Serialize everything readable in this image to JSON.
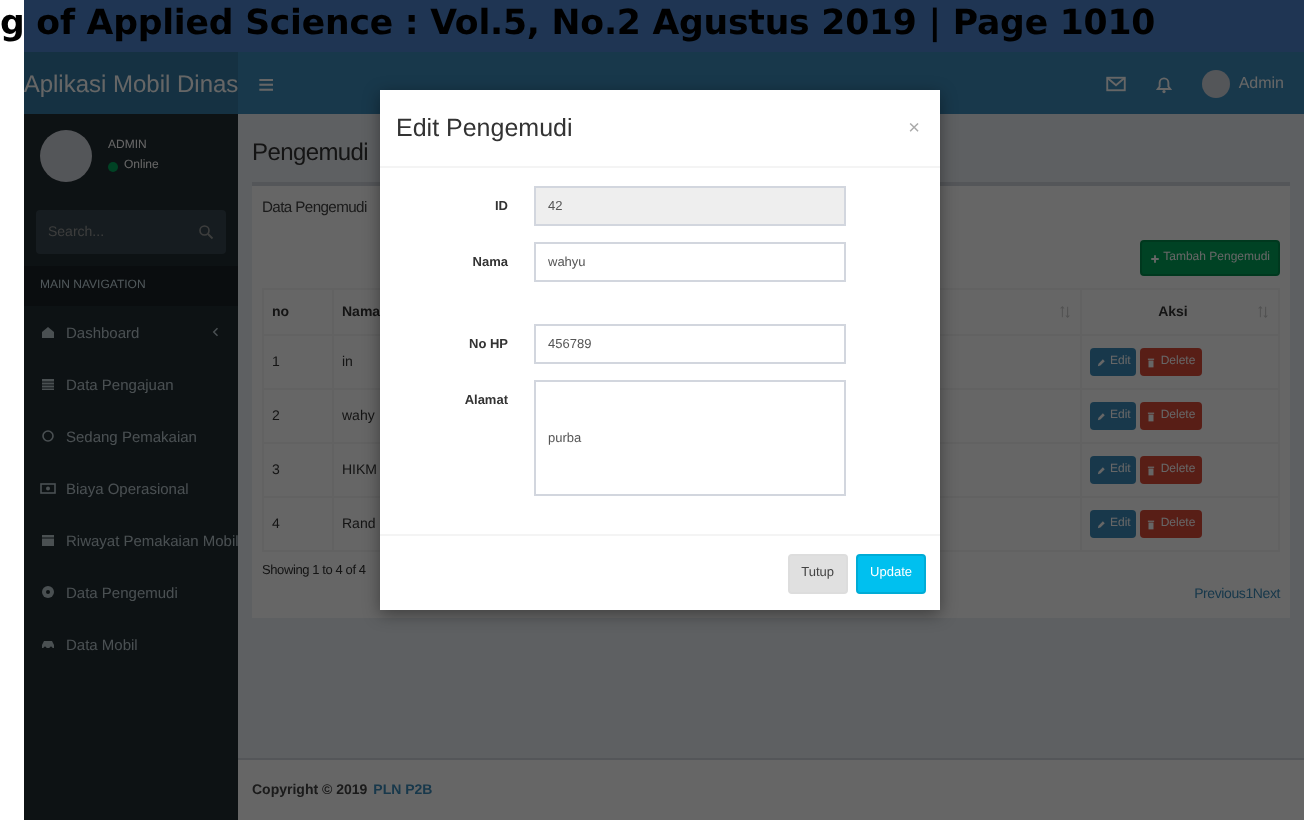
{
  "page_header": "g of Applied Science : Vol.5, No.2 Agustus 2019 | Page 1010",
  "topbar": {
    "brand": "Aplikasi Mobil Dinas",
    "menu": "≡",
    "user_name": "Admin"
  },
  "sidebar": {
    "user": {
      "name": "ADMIN",
      "status": "Online"
    },
    "search": {
      "placeholder": "Search..."
    },
    "section_label": "MAIN NAVIGATION",
    "items": [
      {
        "label": "Dashboard",
        "expandable": true
      },
      {
        "label": "Data Pengajuan",
        "expandable": false
      },
      {
        "label": "Sedang Pemakaian",
        "expandable": false
      },
      {
        "label": "Biaya Operasional",
        "expandable": false
      },
      {
        "label": "Riwayat Pemakaian Mobil",
        "expandable": false
      },
      {
        "label": "Data Pengemudi",
        "expandable": false
      },
      {
        "label": "Data Mobil",
        "expandable": false
      }
    ]
  },
  "content": {
    "title": "Pengemudi",
    "box_title": "Data Pengemudi",
    "add_button": "Tambah Pengemudi",
    "table": {
      "columns": [
        "no",
        "Nama",
        "Aksi"
      ],
      "rows": [
        {
          "no": "1",
          "name": "in",
          "actions": [
            "Edit",
            "Delete"
          ]
        },
        {
          "no": "2",
          "name": "wahy",
          "actions": [
            "Edit",
            "Delete"
          ]
        },
        {
          "no": "3",
          "name": "HIKM",
          "actions": [
            "Edit",
            "Delete"
          ]
        },
        {
          "no": "4",
          "name": "Rand",
          "actions": [
            "Edit",
            "Delete"
          ]
        }
      ]
    },
    "info": "Showing 1 to 4 of 4",
    "pagination": [
      "Previous",
      "1",
      "Next"
    ]
  },
  "footer": {
    "text": "Copyright © 2019",
    "link": "PLN P2B"
  },
  "modal": {
    "title": "Edit Pengemudi",
    "close": "×",
    "fields": [
      {
        "label": "ID",
        "value": "42",
        "kind": "input",
        "disabled": true
      },
      {
        "label": "Nama",
        "value": "wahyu",
        "kind": "input",
        "disabled": false
      },
      {
        "label": "No HP",
        "value": "456789",
        "kind": "input",
        "disabled": false
      },
      {
        "label": "Alamat",
        "value": "purba",
        "kind": "textarea",
        "disabled": false
      }
    ],
    "buttons": [
      {
        "label": "Tutup",
        "kind": "default"
      },
      {
        "label": "Update",
        "kind": "primary"
      }
    ]
  }
}
